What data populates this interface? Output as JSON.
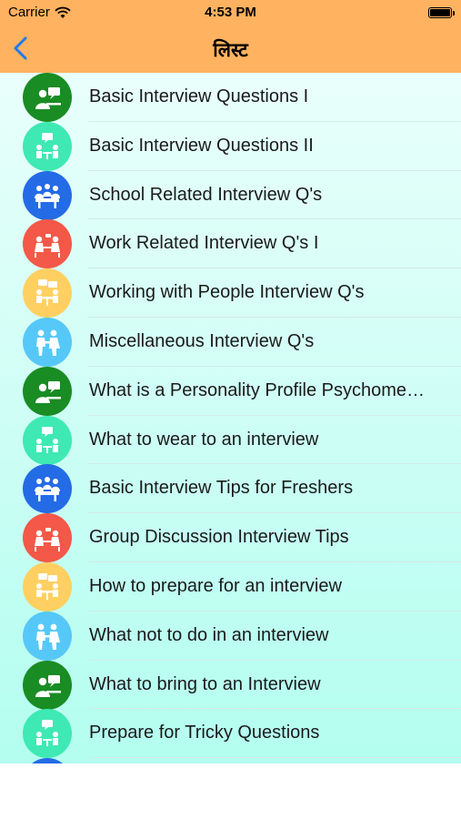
{
  "status_bar": {
    "carrier": "Carrier",
    "time": "4:53 PM"
  },
  "nav": {
    "title": "लिस्ट"
  },
  "colors": {
    "bar": "#FFB25F",
    "accent": "#1E7AF0"
  },
  "list": {
    "items": [
      {
        "label": "Basic Interview Questions I",
        "icon": "interview-icon",
        "color": "#198C23"
      },
      {
        "label": "Basic Interview Questions II",
        "icon": "meeting-icon",
        "color": "#3FE9B3"
      },
      {
        "label": "School Related Interview Q's",
        "icon": "team-icon",
        "color": "#246BE6"
      },
      {
        "label": "Work Related Interview Q's I",
        "icon": "discussion-icon",
        "color": "#F45848"
      },
      {
        "label": "Working with People Interview Q's",
        "icon": "conversation-icon",
        "color": "#FFD061"
      },
      {
        "label": "Miscellaneous Interview Q's",
        "icon": "handshake-icon",
        "color": "#56C8F8"
      },
      {
        "label": "What is a Personality Profile Psychome…",
        "icon": "interview-icon",
        "color": "#198C23"
      },
      {
        "label": "What to wear to an interview",
        "icon": "meeting-icon",
        "color": "#3FE9B3"
      },
      {
        "label": "Basic Interview Tips for Freshers",
        "icon": "team-icon",
        "color": "#246BE6"
      },
      {
        "label": "Group Discussion Interview Tips",
        "icon": "discussion-icon",
        "color": "#F45848"
      },
      {
        "label": "How to prepare for an interview",
        "icon": "conversation-icon",
        "color": "#FFD061"
      },
      {
        "label": "What not to do in an interview",
        "icon": "handshake-icon",
        "color": "#56C8F8"
      },
      {
        "label": "What to bring to an Interview",
        "icon": "interview-icon",
        "color": "#198C23"
      },
      {
        "label": "Prepare for Tricky Questions",
        "icon": "meeting-icon",
        "color": "#3FE9B3"
      },
      {
        "label": "",
        "icon": "team-icon",
        "color": "#246BE6"
      }
    ]
  }
}
